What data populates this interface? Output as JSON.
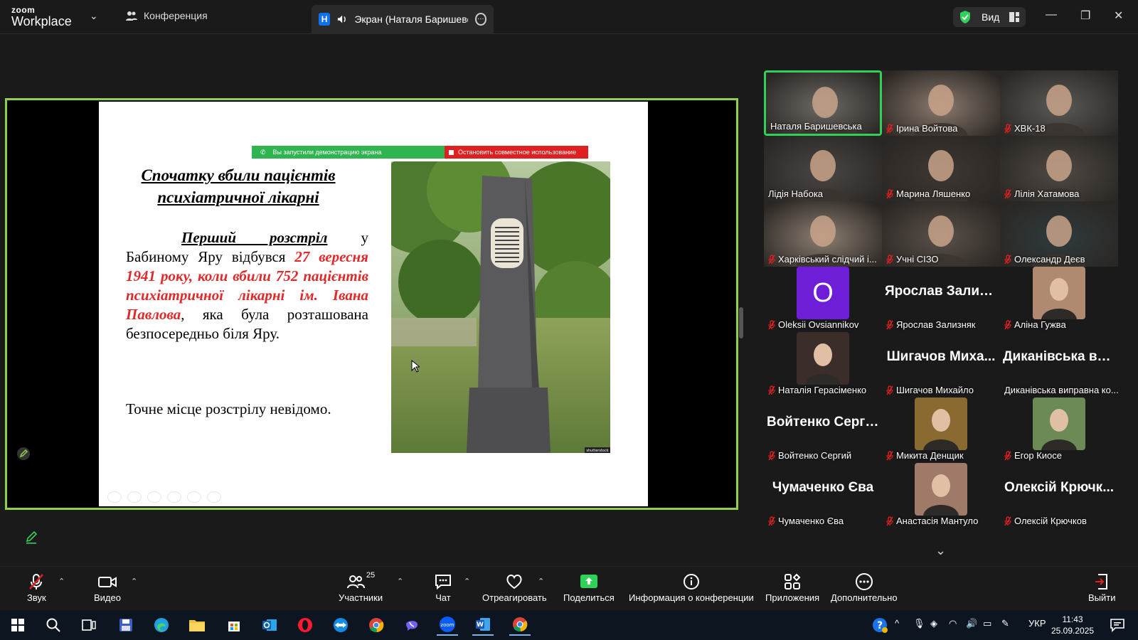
{
  "titlebar": {
    "logo_top": "zoom",
    "logo_bottom": "Workplace",
    "conference_tab": "Конференция",
    "share_tab_badge": "H",
    "share_tab_label": "Экран (Наталя Баришевськ",
    "view_label": "Вид"
  },
  "slide": {
    "banner_left": "Вы запустили демонстрацию экрана",
    "banner_right": "Остановить совместное использование",
    "title": "Спочатку вбили пацієнтів психіатричної лікарні",
    "body_underlined": "Перший розстріл",
    "body_part1": " у Бабиному Яру відбувся ",
    "body_red": "27 вересня 1941 року, коли вбили 752 пацієнтів психіатричної лікарні ім. Івана Павлова",
    "body_part2": ", яка була розташована безпосередньо біля Яру.",
    "note": "Точне місце розстрілу невідомо.",
    "photo_watermark": "shutterstock"
  },
  "participants": [
    {
      "name": "Наталя Баришевська",
      "type": "video",
      "muted": false,
      "active": true,
      "bg": "#6d6a66"
    },
    {
      "name": "Ірина Войтова",
      "type": "video",
      "muted": true,
      "bg": "#8a7a6e"
    },
    {
      "name": "ХВК-18",
      "type": "video",
      "muted": true,
      "bg": "#5b5a56"
    },
    {
      "name": "Лідія Набока",
      "type": "video",
      "muted": false,
      "bg": "#4a4645"
    },
    {
      "name": "Марина Ляшенко",
      "type": "video",
      "muted": true,
      "bg": "#3e3833"
    },
    {
      "name": "Лілія Хатамова",
      "type": "video",
      "muted": true,
      "bg": "#4f4a44"
    },
    {
      "name": "Харківський слідчий і...",
      "type": "video",
      "muted": true,
      "bg": "#8d7f72"
    },
    {
      "name": "Учні СІЗО",
      "type": "video",
      "muted": true,
      "bg": "#5a514a"
    },
    {
      "name": "Олександр Деєв",
      "type": "video",
      "muted": true,
      "bg": "#2f3b3d"
    },
    {
      "name": "Oleksii Ovsiannikov",
      "type": "avatar",
      "muted": true,
      "letter": "O",
      "bg": "#6d1ed6"
    },
    {
      "name": "Ярослав Зализняк",
      "type": "text",
      "muted": true,
      "big": "Ярослав Зализ..."
    },
    {
      "name": "Аліна Гужва",
      "type": "photo",
      "muted": true,
      "bg": "#b08a70"
    },
    {
      "name": "Наталія Герасіменко",
      "type": "photo",
      "muted": true,
      "bg": "#3a2d2a"
    },
    {
      "name": "Шигачов Михайло",
      "type": "text",
      "muted": true,
      "big": "Шигачов Миха..."
    },
    {
      "name": "Диканівська виправна ко...",
      "type": "text",
      "muted": false,
      "big": "Диканівська ви..."
    },
    {
      "name": "Войтенко Сергий",
      "type": "text",
      "muted": true,
      "big": "Войтенко Сергий"
    },
    {
      "name": "Микита Денщик",
      "type": "photo",
      "muted": true,
      "bg": "#8a6a30"
    },
    {
      "name": "Егор Киосе",
      "type": "photo",
      "muted": true,
      "bg": "#6b8a55"
    },
    {
      "name": "Чумаченко Єва",
      "type": "text",
      "muted": true,
      "big": "Чумаченко Єва"
    },
    {
      "name": "Анастасія Мантуло",
      "type": "photo",
      "muted": true,
      "bg": "#a07a68"
    },
    {
      "name": "Олексій Крючков",
      "type": "text",
      "muted": true,
      "big": "Олексій Крючк..."
    }
  ],
  "toolbar": {
    "audio": "Звук",
    "video": "Видео",
    "participants": "Участники",
    "participants_count": "25",
    "chat": "Чат",
    "react": "Отреагировать",
    "share": "Поделиться",
    "info": "Информация о конференции",
    "apps": "Приложения",
    "more": "Дополнительно",
    "leave": "Выйти"
  },
  "taskbar": {
    "lang": "УКР",
    "time": "11:43",
    "date": "25.09.2025"
  },
  "colors": {
    "share_border": "#8fd14f",
    "active_speaker": "#2fd159",
    "muted_red": "#e02020",
    "slide_red": "#e02929",
    "share_green": "#2fb550"
  }
}
